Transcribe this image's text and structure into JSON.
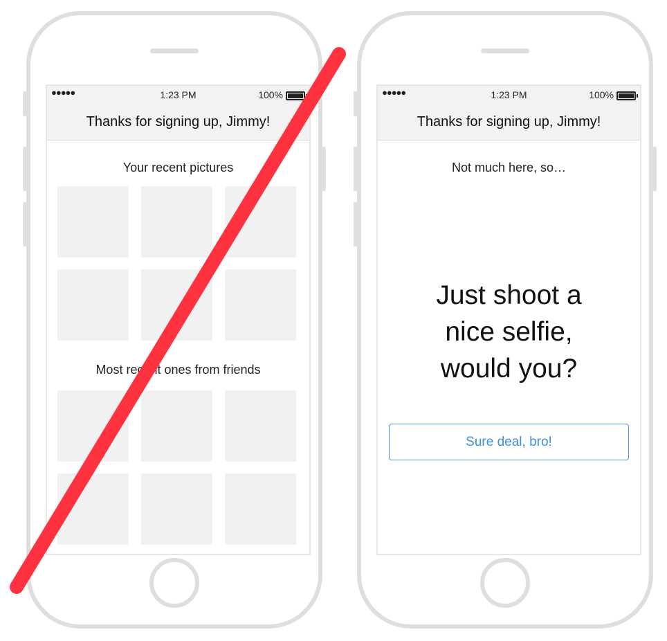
{
  "colors": {
    "strike": "#ff333f",
    "button_accent": "#4a90e2",
    "placeholder_tile": "#f1f1f1",
    "phone_frame": "#dedede"
  },
  "left_phone": {
    "status": {
      "signal": "●●●●●",
      "time": "1:23 PM",
      "battery": "100%"
    },
    "nav_title": "Thanks for signing up, Jimmy!",
    "section1_title": "Your recent pictures",
    "section2_title": "Most recent ones from friends"
  },
  "right_phone": {
    "status": {
      "signal": "●●●●●",
      "time": "1:23 PM",
      "battery": "100%"
    },
    "nav_title": "Thanks for signing up, Jimmy!",
    "empty_title": "Not much here, so…",
    "big_lines": [
      "Just shoot a",
      "nice selfie,",
      "would you?"
    ],
    "button_label": "Sure deal, bro!"
  }
}
